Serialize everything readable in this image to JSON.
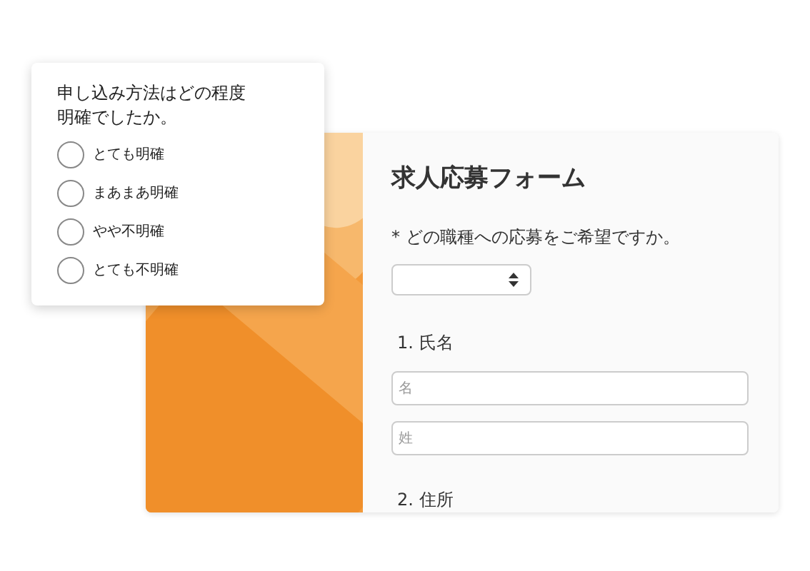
{
  "survey_card": {
    "question": "申し込み方法はどの程度明確でしたか。",
    "options": [
      {
        "label": "とても明確",
        "selected": false
      },
      {
        "label": "まあまあ明確",
        "selected": false
      },
      {
        "label": "やや不明確",
        "selected": false
      },
      {
        "label": "とても不明確",
        "selected": false
      }
    ]
  },
  "form": {
    "title": "求人応募フォーム",
    "job_question": "* どの職種への応募をご希望ですか。",
    "sections": [
      {
        "label": "1. 氏名",
        "fields": [
          {
            "placeholder": "名"
          },
          {
            "placeholder": "姓"
          }
        ]
      },
      {
        "label": "2. 住所"
      }
    ]
  }
}
